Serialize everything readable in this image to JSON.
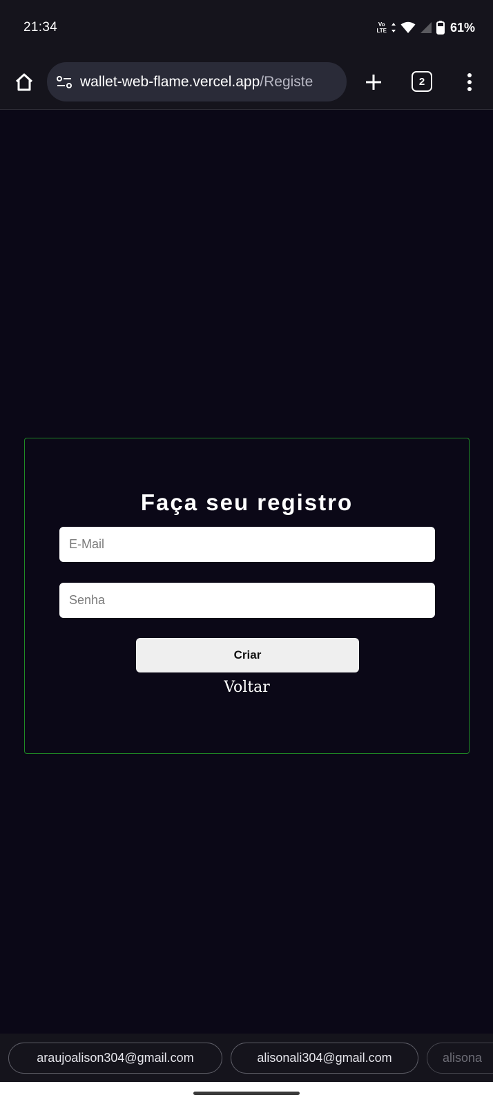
{
  "status_bar": {
    "time": "21:34",
    "network_top": "Vo",
    "network_bottom": "LTE",
    "battery": "61%"
  },
  "browser": {
    "url_host": "wallet-web-flame.vercel.app",
    "url_path": "/Registe",
    "tab_count": "2",
    "icons": [
      "home-icon",
      "site-settings-icon",
      "plus-icon",
      "tab-switcher-icon",
      "more-vert-icon"
    ]
  },
  "form": {
    "title": "Faça seu registro",
    "email_placeholder": "E-Mail",
    "password_placeholder": "Senha",
    "submit_label": "Criar",
    "back_label": "Voltar",
    "border_color": "#1f8a25"
  },
  "autofill": {
    "suggestions": [
      "araujoalison304@gmail.com",
      "alisonali304@gmail.com",
      "alisona"
    ]
  },
  "colors": {
    "background": "#0b0817",
    "chrome": "#15141c",
    "url_box": "#2a2b38"
  }
}
